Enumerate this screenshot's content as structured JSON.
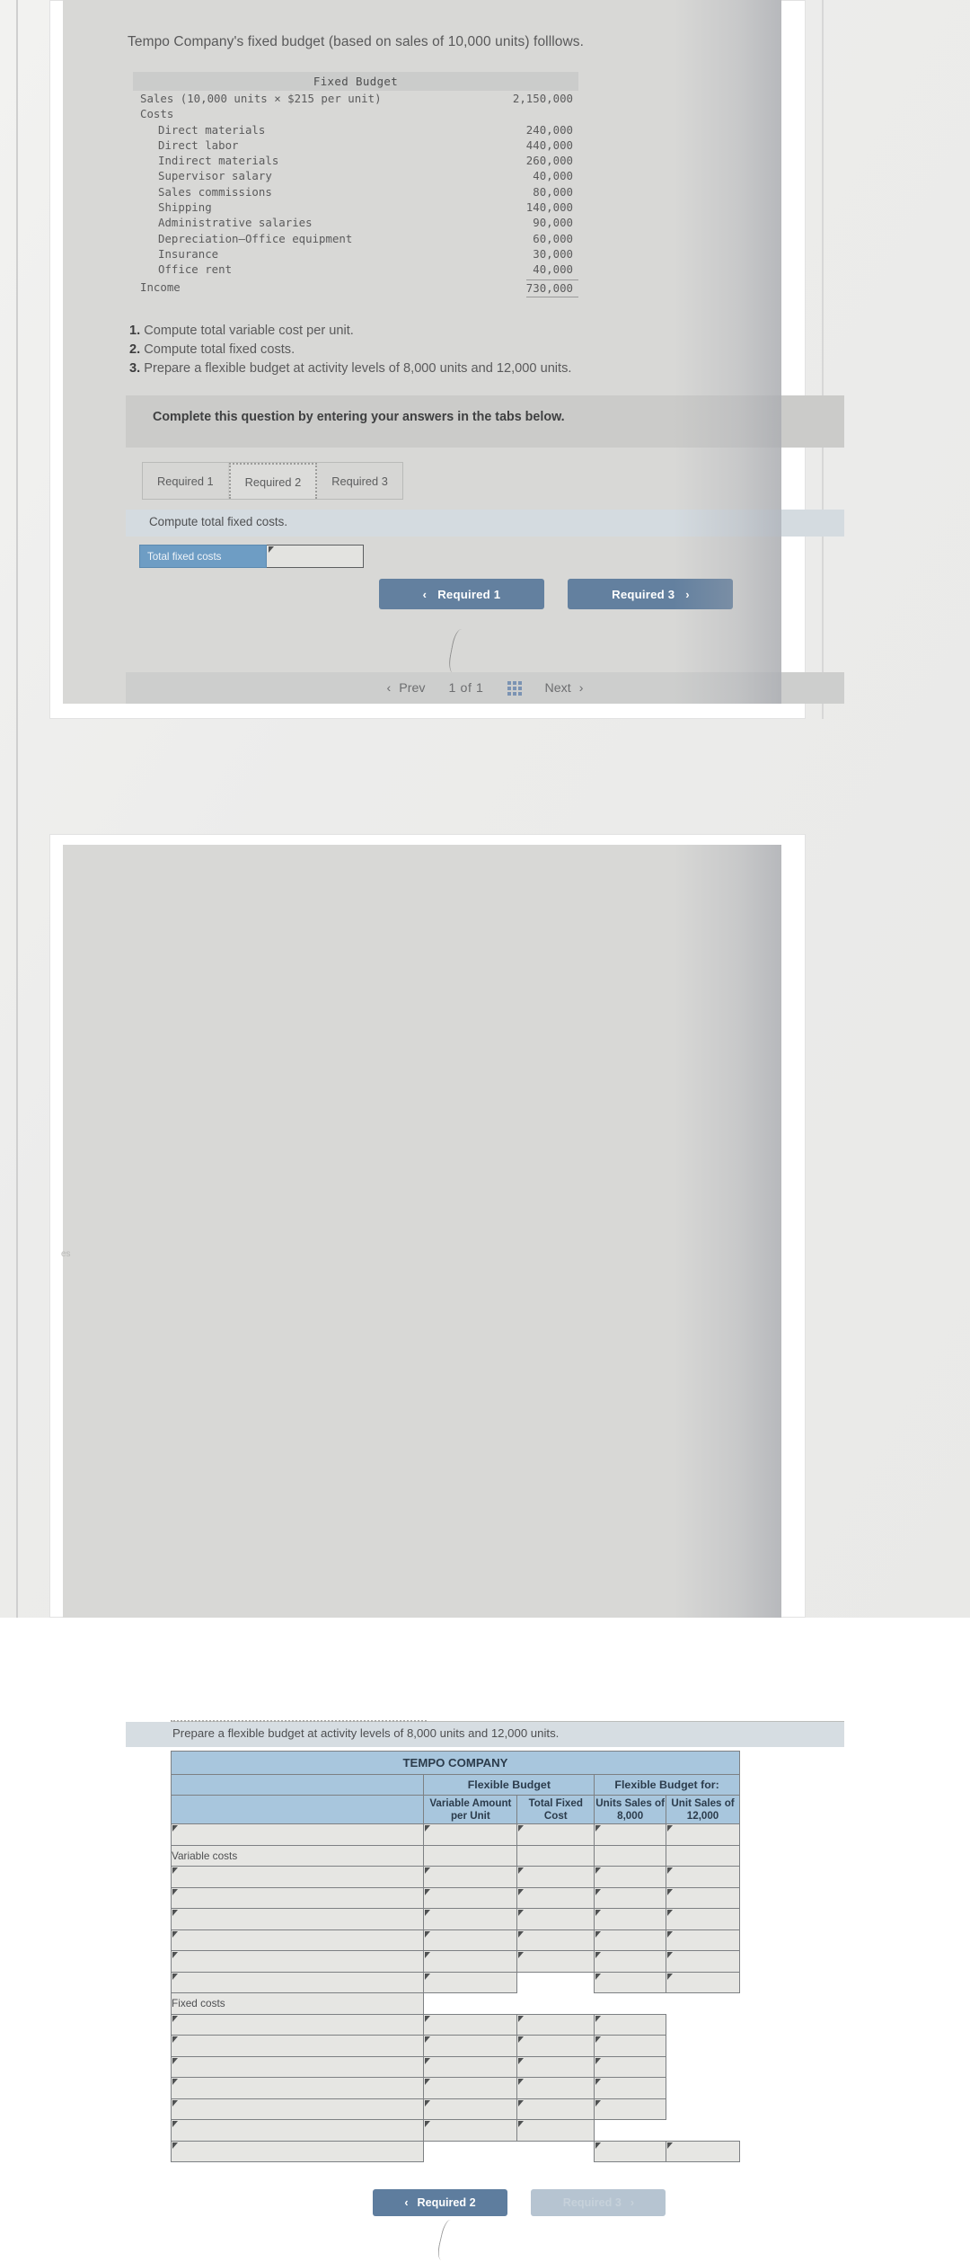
{
  "question": {
    "intro": "Tempo Company's fixed budget (based on sales of 10,000 units) folllows.",
    "requirements": [
      {
        "num": "1.",
        "text": "Compute total variable cost per unit."
      },
      {
        "num": "2.",
        "text": "Compute total fixed costs."
      },
      {
        "num": "3.",
        "text": "Prepare a flexible budget at activity levels of 8,000 units and 12,000 units."
      }
    ],
    "banner": "Complete this question by entering your answers in the tabs below."
  },
  "fixed_budget": {
    "title": "Fixed Budget",
    "sales_label": "Sales (10,000 units × $215 per unit)",
    "sales_value": "2,150,000",
    "costs_label": "Costs",
    "cost_rows": [
      {
        "label": "Direct materials",
        "value": "240,000"
      },
      {
        "label": "Direct labor",
        "value": "440,000"
      },
      {
        "label": "Indirect materials",
        "value": "260,000"
      },
      {
        "label": "Supervisor salary",
        "value": "40,000"
      },
      {
        "label": "Sales commissions",
        "value": "80,000"
      },
      {
        "label": "Shipping",
        "value": "140,000"
      },
      {
        "label": "Administrative salaries",
        "value": "90,000"
      },
      {
        "label": "Depreciation—Office equipment",
        "value": "60,000"
      },
      {
        "label": "Insurance",
        "value": "30,000"
      },
      {
        "label": "Office rent",
        "value": "40,000"
      }
    ],
    "income_label": "Income",
    "income_value": "730,000"
  },
  "tabs": [
    {
      "label": "Required 1",
      "active": false
    },
    {
      "label": "Required 2",
      "active": true
    },
    {
      "label": "Required 3",
      "active": false
    }
  ],
  "required2": {
    "prompt": "Compute total fixed costs.",
    "answer_label": "Total fixed costs",
    "answer_value": "",
    "prev_button": "Required 1",
    "next_button": "Required 3",
    "chevron_left": "‹",
    "chevron_right": "›"
  },
  "pager": {
    "prev": "Prev",
    "position": "1 of 1",
    "next": "Next",
    "grid_icon": "grid-icon",
    "chevron_left": "‹",
    "chevron_right": "›"
  },
  "required3": {
    "prompt": "Prepare a flexible budget at activity levels of 8,000 units and 12,000 units.",
    "company": "TEMPO COMPANY",
    "group_headers": [
      "Flexible Budget",
      "Flexible Budget for:"
    ],
    "column_headers": [
      "Variable Amount per Unit",
      "Total Fixed Cost",
      "Units Sales of 8,000",
      "Unit Sales of 12,000"
    ],
    "section_labels": [
      "Variable costs",
      "Fixed costs"
    ],
    "prev_button": "Required 2",
    "next_button": "Required 3",
    "chevron_left": "‹",
    "chevron_right": "›"
  },
  "colors": {
    "header_blue": "#a8c6dd",
    "button_blue": "#63809f",
    "label_blue": "#6e9dc4",
    "content_grey": "#d8d8d6",
    "banner_grey": "#cbcbc9",
    "prompt_blue": "#d4dbe0"
  }
}
